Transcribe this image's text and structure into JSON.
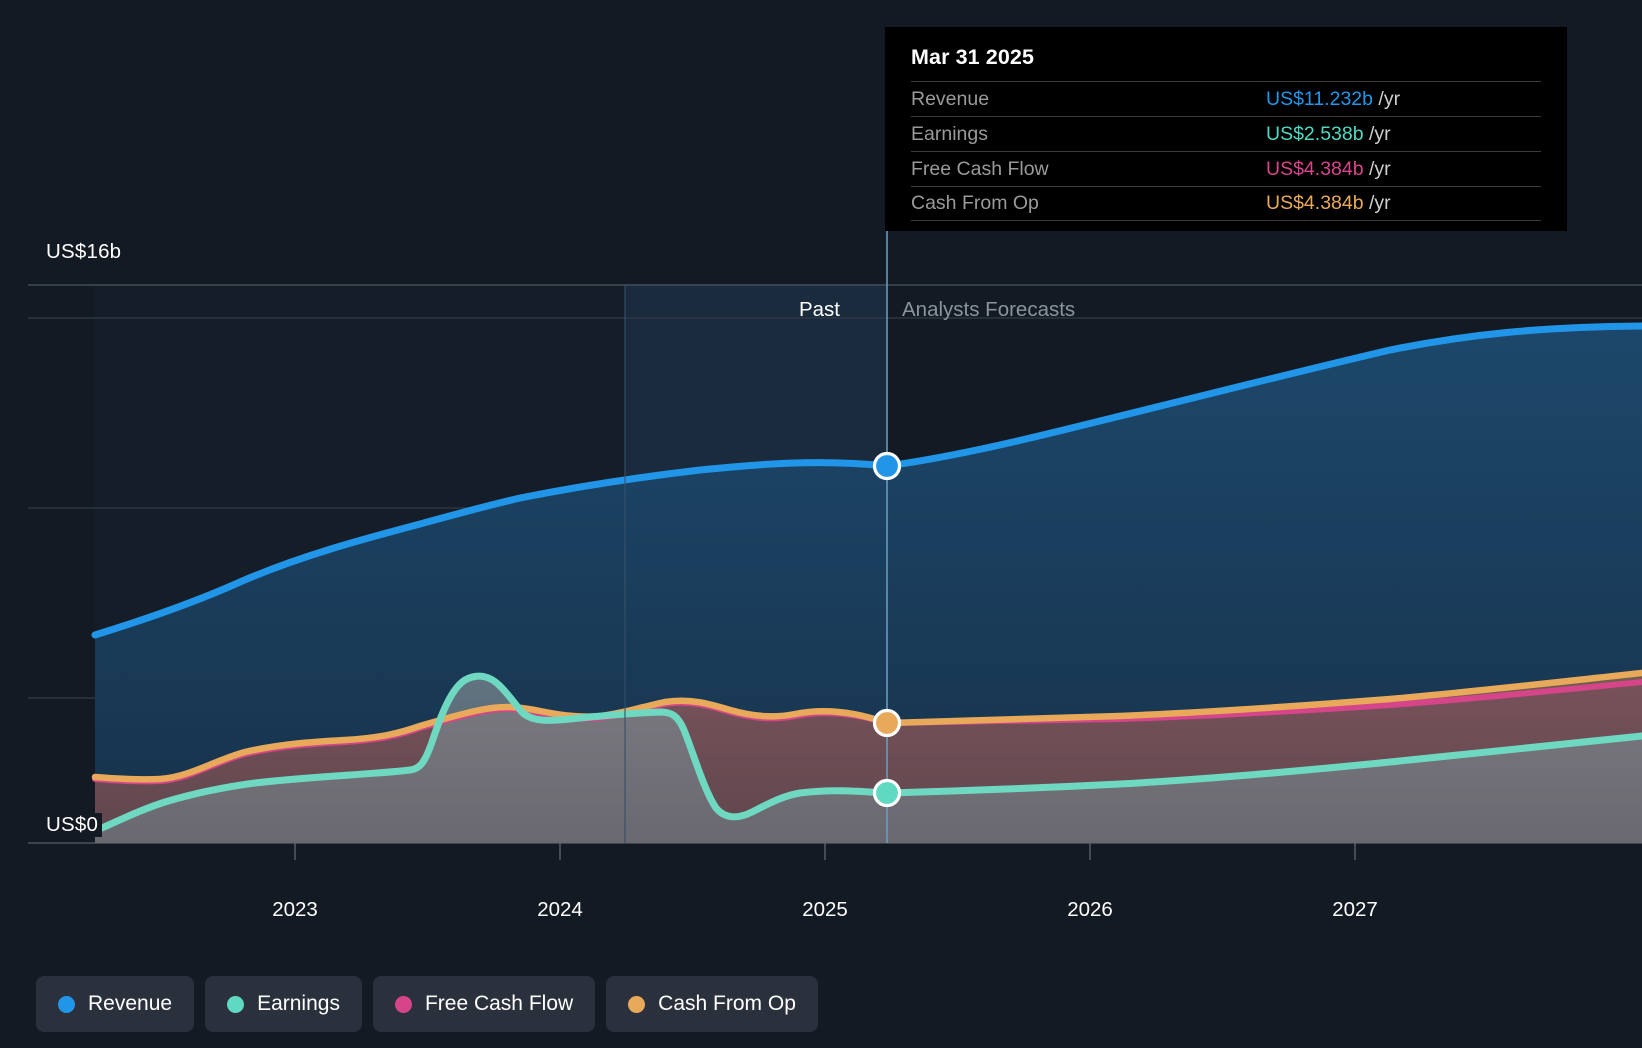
{
  "axis": {
    "y_top_label": "US$16b",
    "y_bottom_label": "US$0",
    "x_ticks": [
      "2023",
      "2024",
      "2025",
      "2026",
      "2027"
    ]
  },
  "bands": {
    "past_label": "Past",
    "forecast_label": "Analysts Forecasts"
  },
  "tooltip": {
    "title": "Mar 31 2025",
    "rows": [
      {
        "metric": "Revenue",
        "amount": "US$11.232b",
        "unit": "/yr",
        "color": "#2196e8"
      },
      {
        "metric": "Earnings",
        "amount": "US$2.538b",
        "unit": "/yr",
        "color": "#4fd9c0"
      },
      {
        "metric": "Free Cash Flow",
        "amount": "US$4.384b",
        "unit": "/yr",
        "color": "#d6458a"
      },
      {
        "metric": "Cash From Op",
        "amount": "US$4.384b",
        "unit": "/yr",
        "color": "#e8a95a"
      }
    ]
  },
  "legend": [
    {
      "label": "Revenue",
      "color": "#2196e8"
    },
    {
      "label": "Earnings",
      "color": "#5fd9c2"
    },
    {
      "label": "Free Cash Flow",
      "color": "#d6458a"
    },
    {
      "label": "Cash From Op",
      "color": "#e8a95a"
    }
  ],
  "colors": {
    "background": "#131a24",
    "gridline": "#3c4452",
    "past_band": "#1b2c3e",
    "divider": "#5a8fb5"
  },
  "chart_data": {
    "type": "area",
    "title": "",
    "xlabel": "",
    "ylabel": "US$",
    "ylim": [
      0,
      16
    ],
    "y_unit": "b",
    "grid": true,
    "legend_position": "bottom-left",
    "x_tick_labels": [
      "2023",
      "2024",
      "2025",
      "2026",
      "2027"
    ],
    "x_range": [
      "2022-07",
      "2027-12"
    ],
    "past_forecast_split": "2025-04",
    "highlight_point": {
      "date": "Mar 31 2025",
      "revenue": 11.232,
      "earnings": 2.538,
      "free_cash_flow": 4.384,
      "cash_from_op": 4.384
    },
    "x": [
      "2022-07",
      "2022-10",
      "2023-01",
      "2023-04",
      "2023-07",
      "2023-10",
      "2024-01",
      "2024-04",
      "2024-07",
      "2024-10",
      "2025-01",
      "2025-04",
      "2025-07",
      "2025-10",
      "2026-01",
      "2026-04",
      "2026-07",
      "2026-10",
      "2027-01",
      "2027-04",
      "2027-07",
      "2027-10",
      "2027-12"
    ],
    "series": [
      {
        "name": "Revenue",
        "color": "#2196e8",
        "fill": "#1c3a53",
        "values": [
          5.95,
          6.8,
          7.55,
          8.0,
          8.5,
          9.1,
          9.55,
          9.9,
          10.2,
          10.5,
          10.9,
          11.23,
          11.6,
          11.95,
          12.3,
          12.65,
          13.0,
          13.35,
          13.7,
          14.05,
          14.4,
          14.7,
          14.95
        ]
      },
      {
        "name": "Earnings",
        "color": "#5fd9c2",
        "fill": "#4a5a63",
        "values": [
          0.35,
          0.95,
          1.45,
          1.7,
          1.85,
          1.95,
          4.6,
          4.2,
          4.35,
          4.4,
          4.4,
          2.2,
          2.55,
          2.53,
          2.6,
          2.7,
          2.82,
          2.95,
          3.1,
          3.25,
          3.4,
          3.55,
          3.65
        ]
      },
      {
        "name": "Free Cash Flow",
        "color": "#d6458a",
        "fill": "#5a3a46",
        "values": [
          2.7,
          2.65,
          3.05,
          3.25,
          3.6,
          3.55,
          3.4,
          3.5,
          3.8,
          3.95,
          4.2,
          4.384,
          4.4,
          4.45,
          4.5,
          4.58,
          4.68,
          4.8,
          4.92,
          5.05,
          5.2,
          5.35,
          5.45
        ]
      },
      {
        "name": "Cash From Op",
        "color": "#e8a95a",
        "fill": "#6b5340",
        "values": [
          2.75,
          2.7,
          3.1,
          3.3,
          3.65,
          3.6,
          3.45,
          3.55,
          3.85,
          4.0,
          4.25,
          4.384,
          4.45,
          4.52,
          4.6,
          4.7,
          4.82,
          4.95,
          5.1,
          5.25,
          5.42,
          5.58,
          5.7
        ]
      }
    ]
  }
}
